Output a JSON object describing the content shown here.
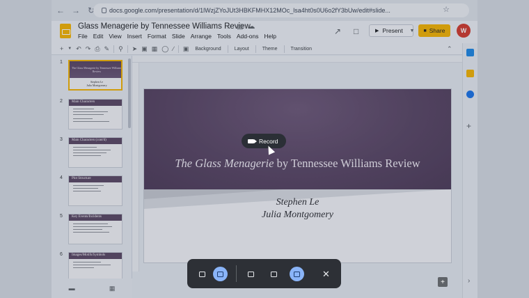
{
  "browser": {
    "url": "docs.google.com/presentation/d/1lWzjZYoJUt3HBKFMHX12MOc_lsa4ht0s0U6o2fY3bUw/edit#slide..."
  },
  "header": {
    "title": "Glass Menagerie by Tennessee Williams Review",
    "menu": [
      "File",
      "Edit",
      "View",
      "Insert",
      "Format",
      "Slide",
      "Arrange",
      "Tools",
      "Add-ons",
      "Help"
    ],
    "present_label": "Present",
    "share_label": "Share",
    "user_initial": "W"
  },
  "toolbar": {
    "background_label": "Background",
    "layout_label": "Layout",
    "theme_label": "Theme",
    "transition_label": "Transition"
  },
  "filmstrip": {
    "slides": [
      {
        "num": "1",
        "title": "The Glass Menagerie by Tennessee Williams Review",
        "subtitle1": "Stephen Le",
        "subtitle2": "Julia Montgomery"
      },
      {
        "num": "2",
        "title": "Main Characters"
      },
      {
        "num": "3",
        "title": "Main Characters (cont'd)"
      },
      {
        "num": "4",
        "title": "Plot Structure"
      },
      {
        "num": "5",
        "title": "Key Events/Incidents"
      },
      {
        "num": "6",
        "title": "Images/Motifs/Symbols"
      }
    ]
  },
  "slide": {
    "title_italic": "The Glass Menagerie",
    "title_rest": " by Tennessee Williams Review",
    "author1": "Stephen Le",
    "author2": "Julia Montgomery"
  },
  "record_pill": {
    "label": "Record"
  },
  "colors": {
    "accent_yellow": "#f6b400",
    "slide_purple": "#5a4664",
    "capture_bar": "#2d3036",
    "capture_selected": "#8ab4f8"
  },
  "capture_bar": {
    "icons": [
      "screenshot-icon",
      "screen-record-icon",
      "fullscreen-icon",
      "partial-icon",
      "window-icon",
      "close-icon"
    ]
  }
}
